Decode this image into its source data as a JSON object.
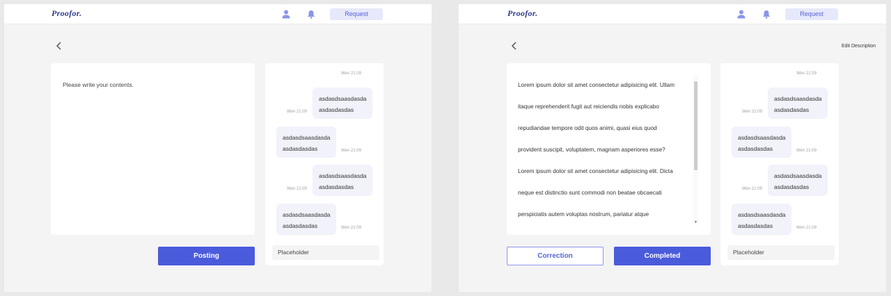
{
  "app": {
    "logo": "Proofor."
  },
  "header": {
    "request_label": "Request"
  },
  "left_screen": {
    "editor_placeholder": "Please write your contents.",
    "posting_label": "Posting"
  },
  "right_screen": {
    "edit_description_label": "Edit Description",
    "description_lines": [
      "Lorem ipsum dolor sit amet consectetur adipisicing elit. Ullam",
      "itaque reprehenderit fugit aut reiciendis nobis explicabo",
      "repudiandae tempore odit quos animi, quasi eius quod",
      "provident suscipit, voluptatem, magnam asperiores esse?",
      "Lorem ipsum dolor sit amet consectetur adipisicing elit. Dicta",
      "neque est distinctio sunt commodi non beatae obcaecati",
      "perspiciatis autem voluptas nostrum, pariatur atque"
    ],
    "correction_label": "Correction",
    "completed_label": "Completed"
  },
  "chat": {
    "messages": [
      {
        "side": "received",
        "line1": "asdasdsaasdasda",
        "line2": "asdasdasdas",
        "time": "Wen 21:09"
      },
      {
        "side": "sent",
        "line1": "asdasdsaasdasda",
        "line2": "asdasdasdas",
        "time": "Wen 21:09"
      },
      {
        "side": "received",
        "line1": "asdasdsaasdasda",
        "line2": "asdasdasdas",
        "time": "Wen 21:09"
      },
      {
        "side": "sent",
        "line1": "asdasdsaasdasda",
        "line2": "asdasdasdas",
        "time": "Wen 21:09"
      },
      {
        "side": "received",
        "line1": "asdasdsaasdasda",
        "line2": "asdasdasdas",
        "time": "Wen 21:09"
      }
    ],
    "input_placeholder": "Placeholder"
  },
  "colors": {
    "primary": "#4a5bdc",
    "request_bg": "#e6e8fb",
    "bubble_bg": "#f1f2fa",
    "logo": "#2c3a8c",
    "icon": "#8b95e8"
  },
  "icons": [
    "user-icon",
    "bell-icon",
    "back-chevron-icon",
    "scroll-down-arrow-icon"
  ]
}
